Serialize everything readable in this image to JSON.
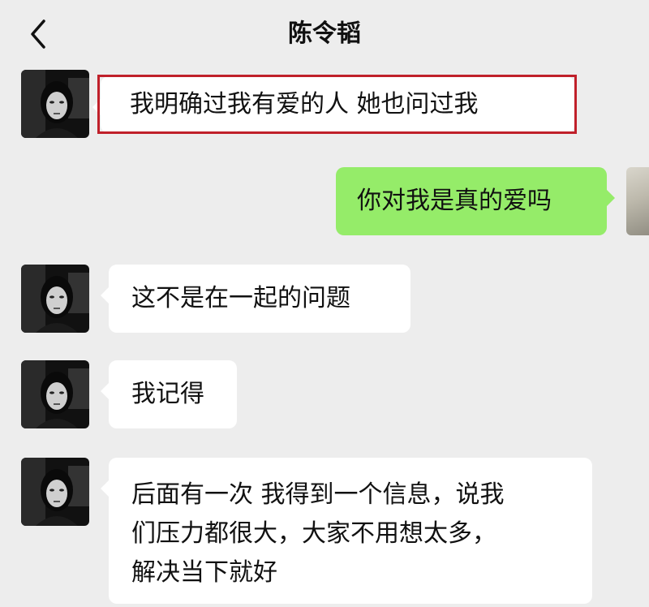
{
  "header": {
    "title": "陈令韬",
    "back_icon": "chevron-left-icon"
  },
  "messages": [
    {
      "side": "left",
      "text": "我明确过我有爱的人 她也问过我",
      "highlighted": true,
      "highlight_color": "#c0202a"
    },
    {
      "side": "right",
      "text": "你对我是真的爱吗",
      "bubble_color": "#95ec69"
    },
    {
      "side": "left",
      "text": "这不是在一起的问题"
    },
    {
      "side": "left",
      "text": "我记得"
    },
    {
      "side": "left",
      "lines": [
        "后面有一次 我得到一个信息，说我",
        "们压力都很大，大家不用想太多，",
        "解决当下就好"
      ]
    }
  ],
  "colors": {
    "background": "#ededed",
    "incoming_bubble": "#ffffff",
    "outgoing_bubble": "#95ec69",
    "highlight": "#c0202a"
  }
}
